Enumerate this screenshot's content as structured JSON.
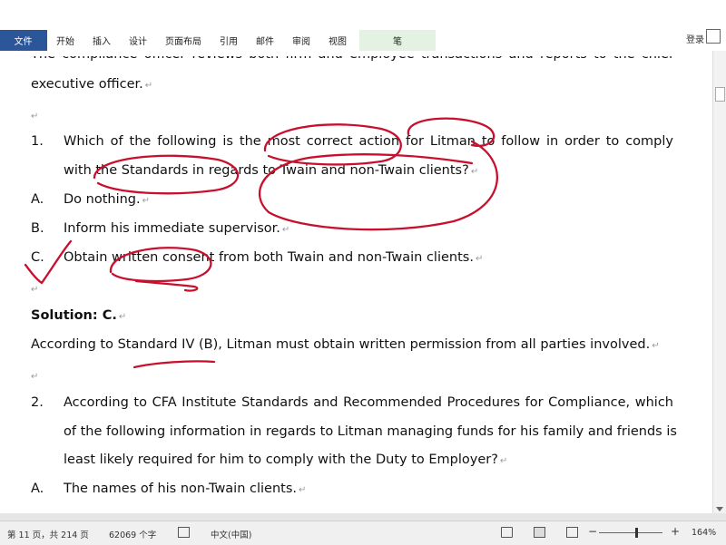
{
  "ribbon": {
    "tabs": [
      "文件",
      "开始",
      "插入",
      "设计",
      "页面布局",
      "引用",
      "邮件",
      "审阅",
      "视图",
      "笔"
    ],
    "login": "登录"
  },
  "doc": {
    "line_top": "The compliance officer reviews both firm and employee transactions and reports to the chief",
    "line_exec": "executive officer.",
    "q1_num": "1.",
    "q1_l1": "Which of the following is the most correct action for Litman to follow in order to comply",
    "q1_l2": "with the Standards in regards to Twain and non-Twain clients?",
    "a_label": "A.",
    "a_text": "Do nothing.",
    "b_label": "B.",
    "b_text": "Inform his immediate supervisor.",
    "c_label": "C.",
    "c_text": "Obtain written consent from both Twain and non-Twain clients.",
    "solution": "Solution: C.",
    "explanation": "According to Standard IV (B), Litman must obtain written permission from all parties involved.",
    "q2_num": "2.",
    "q2_l1": "According to CFA Institute Standards and Recommended Procedures for Compliance, which",
    "q2_l2": "of the following information in regards to Litman managing funds for his family and friends is",
    "q2_l3": "least likely required for him to comply with the Duty to Employer?",
    "q2a_label": "A.",
    "q2a_text": "The names of his non-Twain clients.",
    "return_mark": "↵"
  },
  "status": {
    "page": "第 11 页，共 214 页",
    "words": "62069 个字",
    "language": "中文(中国)",
    "minus": "−",
    "plus": "+",
    "zoom": "164%"
  },
  "colors": {
    "file_tab": "#2b579a",
    "pen_tab": "#e3f2e3",
    "ink": "#c8102e"
  },
  "icons": [
    "proofing-icon",
    "read-mode-icon",
    "print-layout-icon",
    "web-layout-icon"
  ]
}
